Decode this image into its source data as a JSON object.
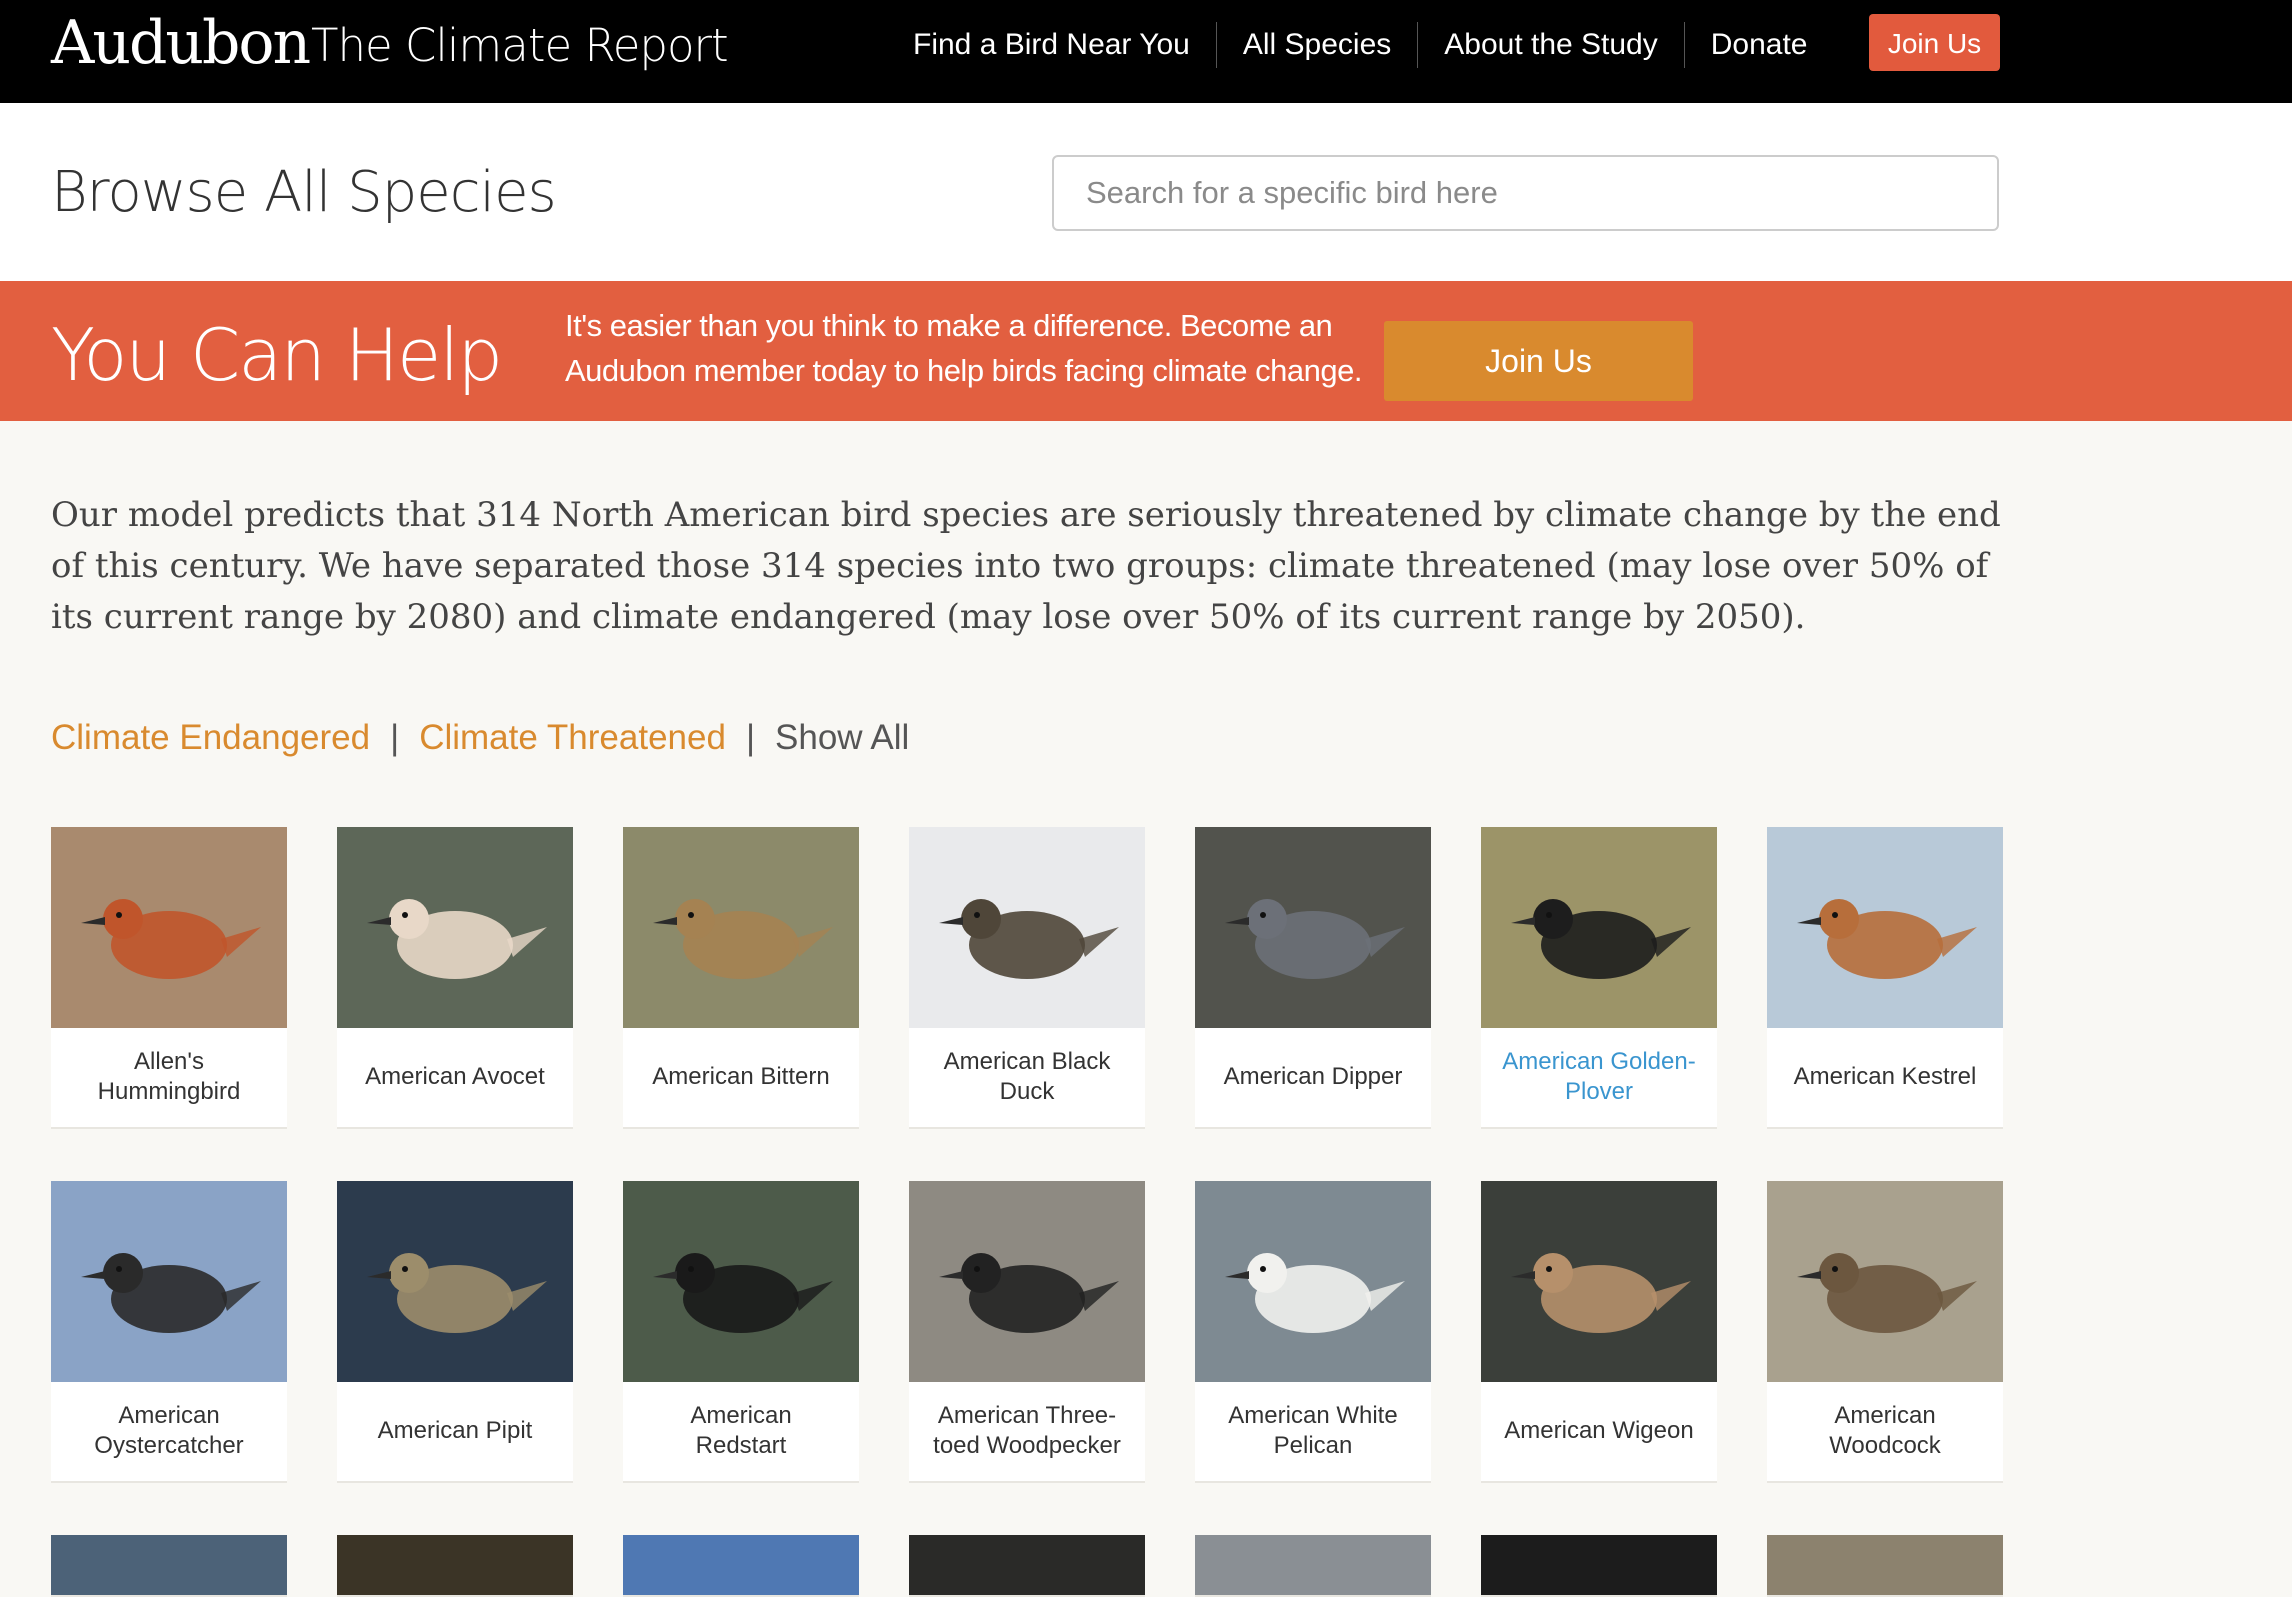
{
  "header": {
    "logo": "Audubon",
    "site_title": "The Climate Report",
    "nav": [
      "Find a Bird Near You",
      "All Species",
      "About the Study",
      "Donate"
    ],
    "join_label": "Join Us"
  },
  "browse": {
    "title": "Browse All Species",
    "search_placeholder": "Search for a specific bird here"
  },
  "help_banner": {
    "title": "You Can Help",
    "text_line1": "It's easier than you think to make a difference. Become an",
    "text_line2": "Audubon member today to help birds facing climate change.",
    "button_label": "Join Us"
  },
  "intro": "Our model predicts that 314 North American bird species are seriously threatened by climate change by the end of this century. We have separated those 314 species into two groups: climate threatened (may lose over 50% of its current range by 2080) and climate endangered (may lose over 50% of its current range by 2050).",
  "filters": {
    "endangered": "Climate Endangered",
    "threatened": "Climate Threatened",
    "show_all": "Show All",
    "separator": "|"
  },
  "species": [
    {
      "name": "Allen's Hummingbird",
      "bg": "#a98a6e",
      "fg": "#c0552b"
    },
    {
      "name": "American Avocet",
      "bg": "#5d6758",
      "fg": "#e8d8c8"
    },
    {
      "name": "American Bittern",
      "bg": "#8c8a6a",
      "fg": "#a58252"
    },
    {
      "name": "American Black Duck",
      "bg": "#e9eaec",
      "fg": "#4f4639"
    },
    {
      "name": "American Dipper",
      "bg": "#52534d",
      "fg": "#6c7078"
    },
    {
      "name": "American Golden-Plover",
      "bg": "#9c9468",
      "fg": "#1d1d1d",
      "highlight": true
    },
    {
      "name": "American Kestrel",
      "bg": "#b8c9d8",
      "fg": "#b76e3b"
    },
    {
      "name": "American Oystercatcher",
      "bg": "#8aa3c6",
      "fg": "#2a2a2a"
    },
    {
      "name": "American Pipit",
      "bg": "#2c3b4d",
      "fg": "#9c8d6b"
    },
    {
      "name": "American Redstart",
      "bg": "#4d5b4a",
      "fg": "#1a1a1a"
    },
    {
      "name": "American Three-toed Woodpecker",
      "bg": "#8e8a82",
      "fg": "#222222"
    },
    {
      "name": "American White Pelican",
      "bg": "#7e8a92",
      "fg": "#f1f1ee"
    },
    {
      "name": "American Wigeon",
      "bg": "#3b3f3a",
      "fg": "#b6906b"
    },
    {
      "name": "American Woodcock",
      "bg": "#a9a18e",
      "fg": "#6c573f"
    },
    {
      "name": "",
      "bg": "#4c6278",
      "fg": "#4c6278"
    },
    {
      "name": "",
      "bg": "#3b3426",
      "fg": "#3b3426"
    },
    {
      "name": "",
      "bg": "#4f78b3",
      "fg": "#4f78b3"
    },
    {
      "name": "",
      "bg": "#2a2a28",
      "fg": "#2a2a28"
    },
    {
      "name": "",
      "bg": "#8a8f94",
      "fg": "#8a8f94"
    },
    {
      "name": "",
      "bg": "#1c1c1c",
      "fg": "#1c1c1c"
    },
    {
      "name": "",
      "bg": "#8c826e",
      "fg": "#8c826e"
    }
  ],
  "colors": {
    "accent_orange": "#e25f40",
    "button_gold": "#d98a2e",
    "link_blue": "#3a95cf"
  }
}
